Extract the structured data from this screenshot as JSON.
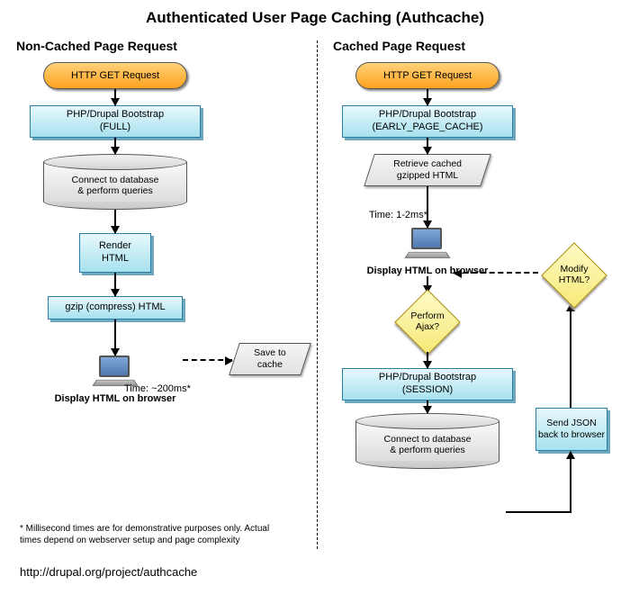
{
  "title": "Authenticated User Page Caching (Authcache)",
  "left": {
    "heading": "Non-Cached Page Request",
    "terminator": "HTTP GET Request",
    "bootstrap": "PHP/Drupal Bootstrap\n(FULL)",
    "db": "Connect to database\n& perform queries",
    "render": "Render\nHTML",
    "gzip": "gzip (compress) HTML",
    "save": "Save to\ncache",
    "time": "Time: ~200ms*",
    "display": "Display HTML on browser"
  },
  "right": {
    "heading": "Cached Page Request",
    "terminator": "HTTP GET Request",
    "bootstrap": "PHP/Drupal Bootstrap\n(EARLY_PAGE_CACHE)",
    "retrieve": "Retrieve cached\ngzipped HTML",
    "time": "Time: 1-2ms*",
    "display": "Display HTML on browser",
    "ajax": "Perform\nAjax?",
    "session": "PHP/Drupal Bootstrap\n(SESSION)",
    "db": "Connect to database\n& perform queries",
    "sendjson": "Send JSON\nback to\nbrowser",
    "modify": "Modify\nHTML?"
  },
  "footnote": "* Millisecond times are for demonstrative purposes only. Actual times depend on webserver setup and page complexity",
  "url": "http://drupal.org/project/authcache"
}
